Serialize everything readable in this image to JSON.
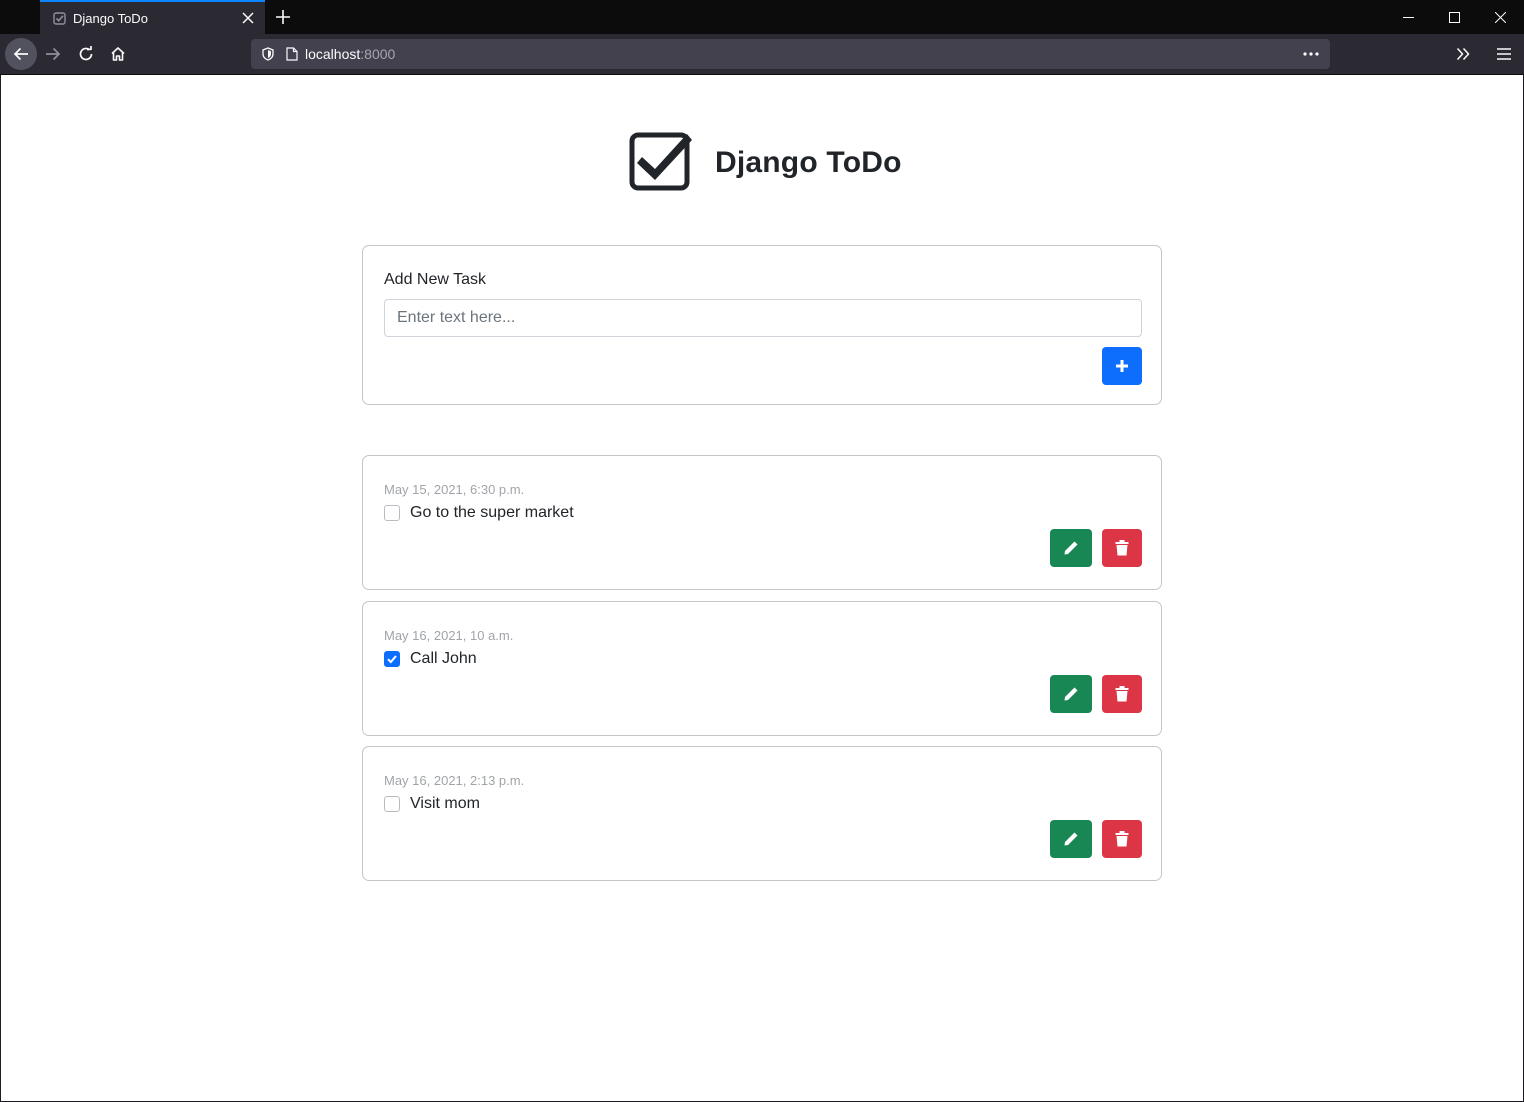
{
  "browser": {
    "tab_title": "Django ToDo",
    "url_host": "localhost",
    "url_port": ":8000"
  },
  "header": {
    "title": "Django ToDo"
  },
  "add_task": {
    "label": "Add New Task",
    "placeholder": "Enter text here...",
    "value": ""
  },
  "tasks": [
    {
      "date": "May 15, 2021, 6:30 p.m.",
      "text": "Go to the super market",
      "completed": false
    },
    {
      "date": "May 16, 2021, 10 a.m.",
      "text": "Call John",
      "completed": true
    },
    {
      "date": "May 16, 2021, 2:13 p.m.",
      "text": "Visit mom",
      "completed": false
    }
  ],
  "colors": {
    "primary": "#0d6efd",
    "success": "#198754",
    "danger": "#dc3545"
  }
}
